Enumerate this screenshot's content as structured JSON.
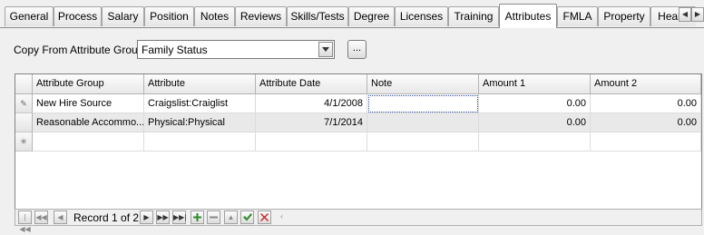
{
  "tabs": [
    {
      "label": "General"
    },
    {
      "label": "Process"
    },
    {
      "label": "Salary"
    },
    {
      "label": "Position"
    },
    {
      "label": "Notes"
    },
    {
      "label": "Reviews"
    },
    {
      "label": "Skills/Tests"
    },
    {
      "label": "Degree"
    },
    {
      "label": "Licenses"
    },
    {
      "label": "Training"
    },
    {
      "label": "Attributes"
    },
    {
      "label": "FMLA"
    },
    {
      "label": "Property"
    },
    {
      "label": "Health"
    }
  ],
  "active_tab": "Attributes",
  "copy_from": {
    "label": "Copy From Attribute Group",
    "value": "Family Status",
    "ellipsis": "..."
  },
  "grid": {
    "columns": [
      "Attribute Group",
      "Attribute",
      "Attribute Date",
      "Note",
      "Amount 1",
      "Amount 2"
    ],
    "rows": [
      {
        "group": "New Hire Source",
        "attribute": "Craigslist:Craiglist",
        "date": "4/1/2008",
        "note": "",
        "amount1": "0.00",
        "amount2": "0.00"
      },
      {
        "group": "Reasonable Accommo...",
        "attribute": "Physical:Physical",
        "date": "7/1/2014",
        "note": "",
        "amount1": "0.00",
        "amount2": "0.00"
      }
    ]
  },
  "navigator": {
    "record_text": "Record 1 of 2"
  },
  "colors": {
    "add": "#2e8b2e",
    "delete": "#cc2222",
    "post": "#2e8b2e"
  }
}
